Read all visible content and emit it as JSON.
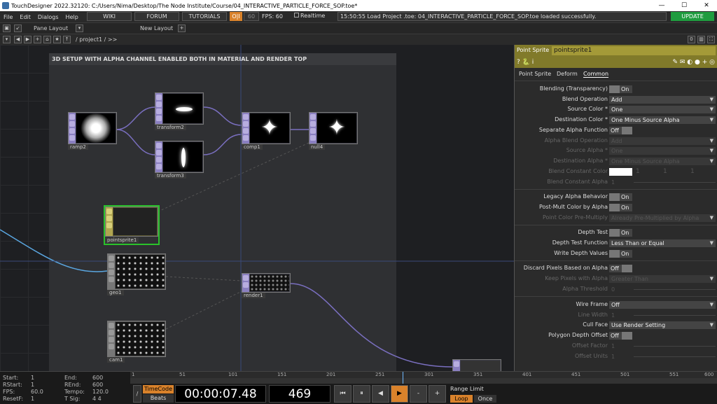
{
  "window": {
    "title": "TouchDesigner 2022.32120: C:/Users/Nima/Desktop/The Node Institute/Course/04_INTERACTIVE_PARTICLE_FORCE_SOP.toe*",
    "minimize": "—",
    "maximize": "☐",
    "close": "✕"
  },
  "menu": [
    "File",
    "Edit",
    "Dialogs",
    "Help"
  ],
  "toolbar": {
    "wiki": "WIKI",
    "forum": "FORUM",
    "tutorials": "TUTORIALS",
    "oi": "O|I",
    "fps_target": "60",
    "fps_label": "FPS:",
    "fps_value": "60",
    "realtime": "Realtime",
    "status": "15:50:55 Load Project .toe: 04_INTERACTIVE_PARTICLE_FORCE_SOP.toe loaded successfully.",
    "update": "UPDATE"
  },
  "pane": {
    "pane_layout": "Pane Layout",
    "new_layout": "New Layout",
    "plus": "+",
    "path": "/ project1 / >>",
    "right_zero": "0"
  },
  "annotation": "3D SETUP WITH ALPHA CHANNEL ENABLED BOTH IN MATERIAL AND RENDER TOP",
  "nodes": {
    "ramp2": "ramp2",
    "transform2": "transform2",
    "transform3": "transform3",
    "comp1": "comp1",
    "null4": "null4",
    "pointsprite1": "pointsprite1",
    "geo1": "geo1",
    "render1": "render1",
    "cam1": "cam1"
  },
  "params": {
    "type": "Point Sprite",
    "name": "pointsprite1",
    "icons": "? 🐍 i",
    "tabs": [
      "Point Sprite",
      "Deform",
      "Common"
    ],
    "blending": {
      "label": "Blending (Transparency)",
      "value": "On"
    },
    "blend_op": {
      "label": "Blend Operation",
      "value": "Add"
    },
    "source_color": {
      "label": "Source Color *",
      "value": "One"
    },
    "dest_color": {
      "label": "Destination Color *",
      "value": "One Minus Source Alpha"
    },
    "sep_alpha": {
      "label": "Separate Alpha Function",
      "value": "Off"
    },
    "alpha_blend_op": {
      "label": "Alpha Blend Operation",
      "value": "Add"
    },
    "source_alpha": {
      "label": "Source Alpha *",
      "value": "One"
    },
    "dest_alpha": {
      "label": "Destination Alpha *",
      "value": "One Minus Source Alpha"
    },
    "blend_const_color": {
      "label": "Blend Constant Color",
      "v2": "1",
      "v3": "1",
      "v4": "1"
    },
    "blend_const_alpha": {
      "label": "Blend Constant Alpha",
      "value": "1"
    },
    "legacy_alpha": {
      "label": "Legacy Alpha Behavior",
      "value": "On"
    },
    "postmult": {
      "label": "Post-Mult Color by Alpha",
      "value": "On"
    },
    "point_color_premult": {
      "label": "Point Color Pre-Multiply",
      "value": "Already Pre-Multiplied by Alpha"
    },
    "depth_test": {
      "label": "Depth Test",
      "value": "On"
    },
    "depth_func": {
      "label": "Depth Test Function",
      "value": "Less Than or Equal"
    },
    "write_depth": {
      "label": "Write Depth Values",
      "value": "On"
    },
    "discard": {
      "label": "Discard Pixels Based on Alpha",
      "value": "Off"
    },
    "keep_pixels": {
      "label": "Keep Pixels with Alpha",
      "value": "Greater Than"
    },
    "alpha_threshold": {
      "label": "Alpha Threshold",
      "value": "0"
    },
    "wireframe": {
      "label": "Wire Frame",
      "value": "Off"
    },
    "line_width": {
      "label": "Line Width",
      "value": "1"
    },
    "cull_face": {
      "label": "Cull Face",
      "value": "Use Render Setting"
    },
    "poly_offset": {
      "label": "Polygon Depth Offset",
      "value": "Off"
    },
    "offset_factor": {
      "label": "Offset Factor",
      "value": "1"
    },
    "offset_units": {
      "label": "Offset Units",
      "value": "1"
    }
  },
  "timeline": {
    "start_l": "Start:",
    "start": "1",
    "end_l": "End:",
    "end": "600",
    "rstart_l": "RStart:",
    "rstart": "1",
    "rend_l": "REnd:",
    "rend": "600",
    "fps_l": "FPS:",
    "fps": "60.0",
    "tempo_l": "Tempo:",
    "tempo": "120.0",
    "resetf_l": "ResetF:",
    "resetf": "1",
    "tsig_l": "T Sig:",
    "tsig": "4    4",
    "ruler": [
      "1",
      "51",
      "101",
      "151",
      "201",
      "251",
      "301",
      "351",
      "401",
      "451",
      "501",
      "551",
      "600"
    ],
    "timecode_btn": "TimeCode",
    "beats_btn": "Beats",
    "timecode": "00:00:07.48",
    "frame": "469",
    "range_limit": "Range Limit",
    "loop": "Loop",
    "once": "Once"
  }
}
